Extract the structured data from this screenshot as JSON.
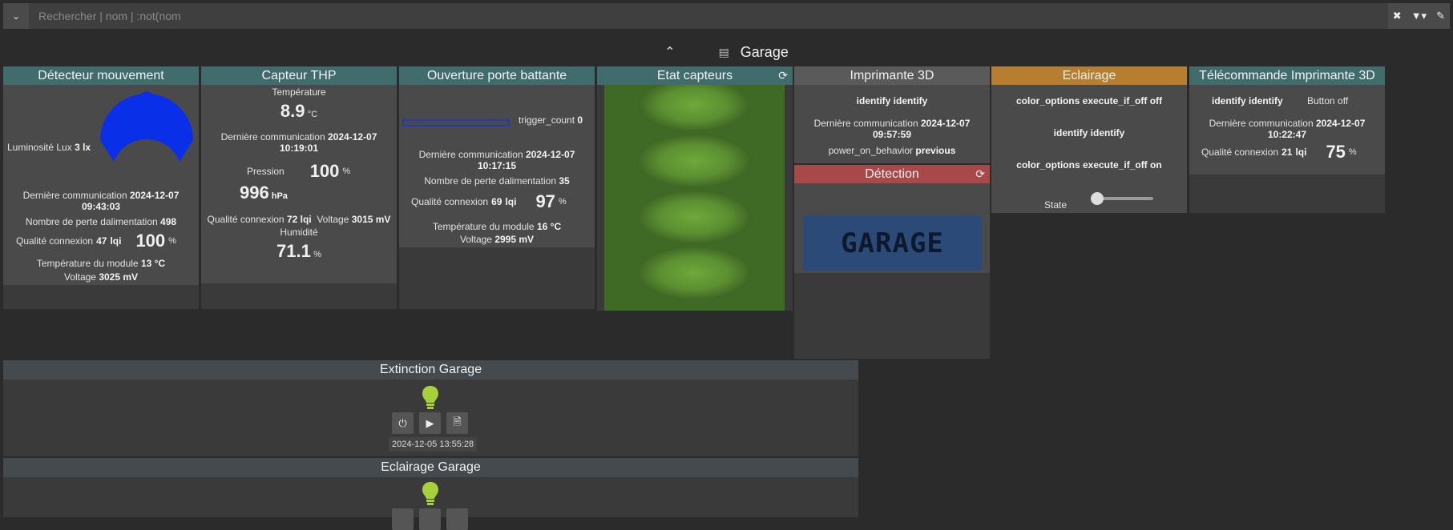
{
  "search": {
    "placeholder": "Rechercher | nom | :not(nom"
  },
  "object": {
    "name": "Garage"
  },
  "tiles": {
    "motion": {
      "title": "Détecteur mouvement",
      "lux_label": "Luminosité Lux",
      "lux_value": "3",
      "lux_unit": "lx",
      "lastcomm_label": "Dernière communication",
      "lastcomm_value": "2024-12-07",
      "lastcomm_time": "09:43:03",
      "loss_label": "Nombre de perte dalimentation",
      "loss_value": "498",
      "quality_label": "Qualité connexion",
      "quality_value": "47",
      "quality_unit": "lqi",
      "battery_value": "100",
      "battery_unit": "%",
      "temp_label": "Température du module",
      "temp_value": "13",
      "temp_unit": "°C",
      "voltage_label": "Voltage",
      "voltage_value": "3025",
      "voltage_unit": "mV"
    },
    "thp": {
      "title": "Capteur THP",
      "temp_label": "Température",
      "temp_value": "8.9",
      "temp_unit": "°C",
      "lastcomm_label": "Dernière communication",
      "lastcomm_value": "2024-12-07",
      "lastcomm_time": "10:19:01",
      "pressure_label": "Pression",
      "pressure_pct": "100",
      "pressure_pct_unit": "%",
      "pressure_value": "996",
      "pressure_unit": "hPa",
      "quality_label": "Qualité connexion",
      "quality_value": "72",
      "quality_unit": "lqi",
      "voltage_label": "Voltage",
      "voltage_value": "3015",
      "voltage_unit": "mV",
      "humidity_label": "Humidité",
      "humidity_value": "71.1",
      "humidity_unit": "%"
    },
    "door": {
      "title": "Ouverture porte battante",
      "trigger_label": "trigger_count",
      "trigger_value": "0",
      "lastcomm_label": "Dernière communication",
      "lastcomm_value": "2024-12-07",
      "lastcomm_time": "10:17:15",
      "loss_label": "Nombre de perte dalimentation",
      "loss_value": "35",
      "quality_label": "Qualité connexion",
      "quality_value": "69",
      "quality_unit": "lqi",
      "battery_value": "97",
      "battery_unit": "%",
      "temp_label": "Température du module",
      "temp_value": "16",
      "temp_unit": "°C",
      "voltage_label": "Voltage",
      "voltage_value": "2995",
      "voltage_unit": "mV"
    },
    "sensors": {
      "title": "Etat capteurs",
      "refresh_icon": "refresh-icon"
    },
    "printer": {
      "title": "Imprimante 3D",
      "identify_label": "identify",
      "identify_value": "identify",
      "lastcomm_label": "Dernière communication",
      "lastcomm_value": "2024-12-07",
      "lastcomm_time": "09:57:59",
      "power_label": "power_on_behavior",
      "power_value": "previous"
    },
    "detection": {
      "title": "Détection",
      "image_text": "GARAGE"
    },
    "lighting": {
      "title": "Eclairage",
      "off_label": "color_options",
      "off_cmd": "execute_if_off",
      "off_value": "off",
      "identify_label": "identify",
      "identify_value": "identify",
      "on_label": "color_options",
      "on_cmd": "execute_if_off",
      "on_value": "on",
      "state_label": "State"
    },
    "remote": {
      "title": "Télécommande Imprimante 3D",
      "identify_label": "identify",
      "identify_value": "identify",
      "button_label": "Button",
      "button_value": "off",
      "lastcomm_label": "Dernière communication",
      "lastcomm_value": "2024-12-07",
      "lastcomm_time": "10:22:47",
      "quality_label": "Qualité connexion",
      "quality_value": "21",
      "quality_unit": "lqi",
      "battery_value": "75",
      "battery_unit": "%"
    }
  },
  "scenarios": [
    {
      "title": "Extinction Garage",
      "date": "2024-12-05 13:55:28"
    },
    {
      "title": "Eclairage Garage"
    }
  ],
  "colors": {
    "bulb": "#a6d13a",
    "bar_border": "#1f3bb8",
    "header_teal": "#406c6c",
    "header_orange": "#b77e2f",
    "header_red": "#a84848"
  }
}
